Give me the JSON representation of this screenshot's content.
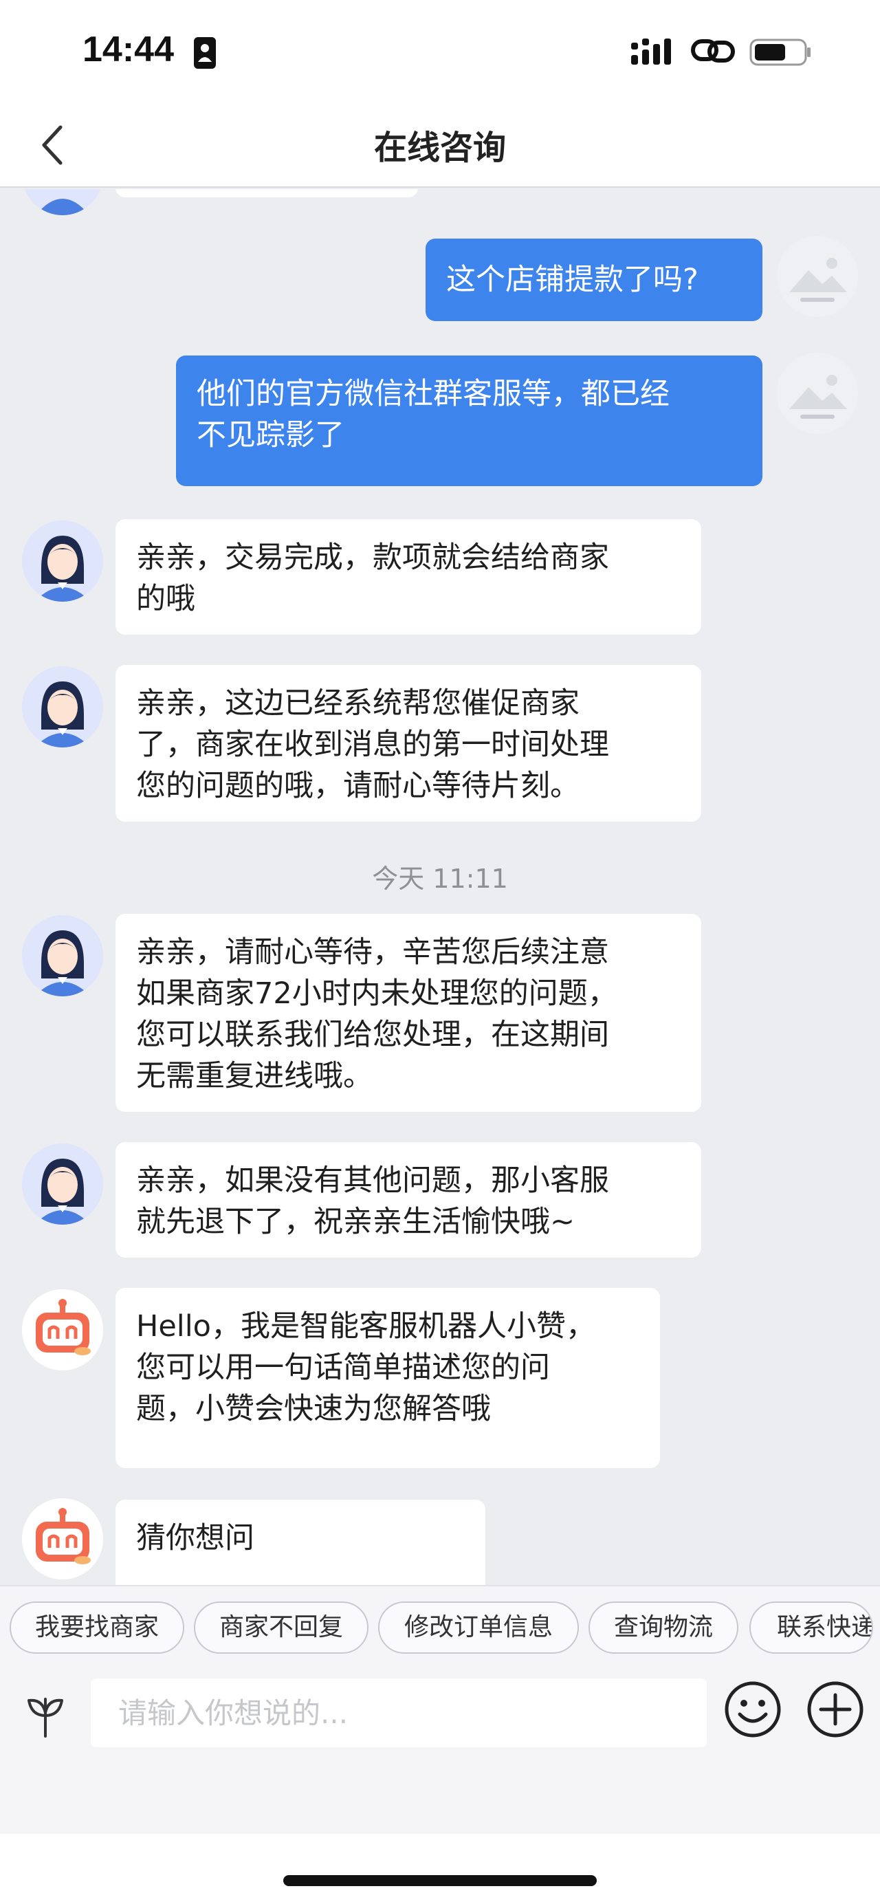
{
  "status_bar": {
    "time": "14:44",
    "icons": [
      "id-badge-icon",
      "signal-icon",
      "link-icon",
      "battery-icon"
    ]
  },
  "nav": {
    "title": "在线咨询",
    "back_icon": "chevron-left-icon"
  },
  "messages": [
    {
      "side": "right",
      "avatar": "image-placeholder-icon",
      "text": "这个店铺提款了吗?"
    },
    {
      "side": "right",
      "avatar": "image-placeholder-icon",
      "text": "他们的官方微信社群客服等，都已经\n不见踪影了"
    },
    {
      "side": "left",
      "avatar": "agent-avatar-icon",
      "text": "亲亲，交易完成，款项就会结给商家\n的哦"
    },
    {
      "side": "left",
      "avatar": "agent-avatar-icon",
      "text": "亲亲，这边已经系统帮您催促商家\n了，商家在收到消息的第一时间处理\n您的问题的哦，请耐心等待片刻。"
    },
    {
      "side": "left",
      "avatar": "agent-avatar-icon",
      "text": "亲亲，请耐心等待，辛苦您后续注意\n如果商家72小时内未处理您的问题，\n您可以联系我们给您处理，在这期间\n无需重复进线哦。"
    },
    {
      "side": "left",
      "avatar": "agent-avatar-icon",
      "text": "亲亲，如果没有其他问题，那小客服\n就先退下了，祝亲亲生活愉快哦~"
    },
    {
      "side": "left",
      "avatar": "robot-avatar-icon",
      "text": "Hello，我是智能客服机器人小赞，\n您可以用一句话简单描述您的问\n题，小赞会快速为您解答哦"
    },
    {
      "side": "left",
      "avatar": "robot-avatar-icon",
      "text": "猜你想问"
    }
  ],
  "time_divider": "今天 11:11",
  "quick_replies": [
    "我要找商家",
    "商家不回复",
    "修改订单信息",
    "查询物流",
    "联系快递"
  ],
  "input": {
    "placeholder": "请输入你想说的...",
    "value": ""
  },
  "input_icons": [
    "voice-icon",
    "emoji-icon",
    "plus-icon"
  ],
  "colors": {
    "accent": "#3d84ec",
    "background": "#ecedf1",
    "bubble_in": "#ffffff"
  }
}
